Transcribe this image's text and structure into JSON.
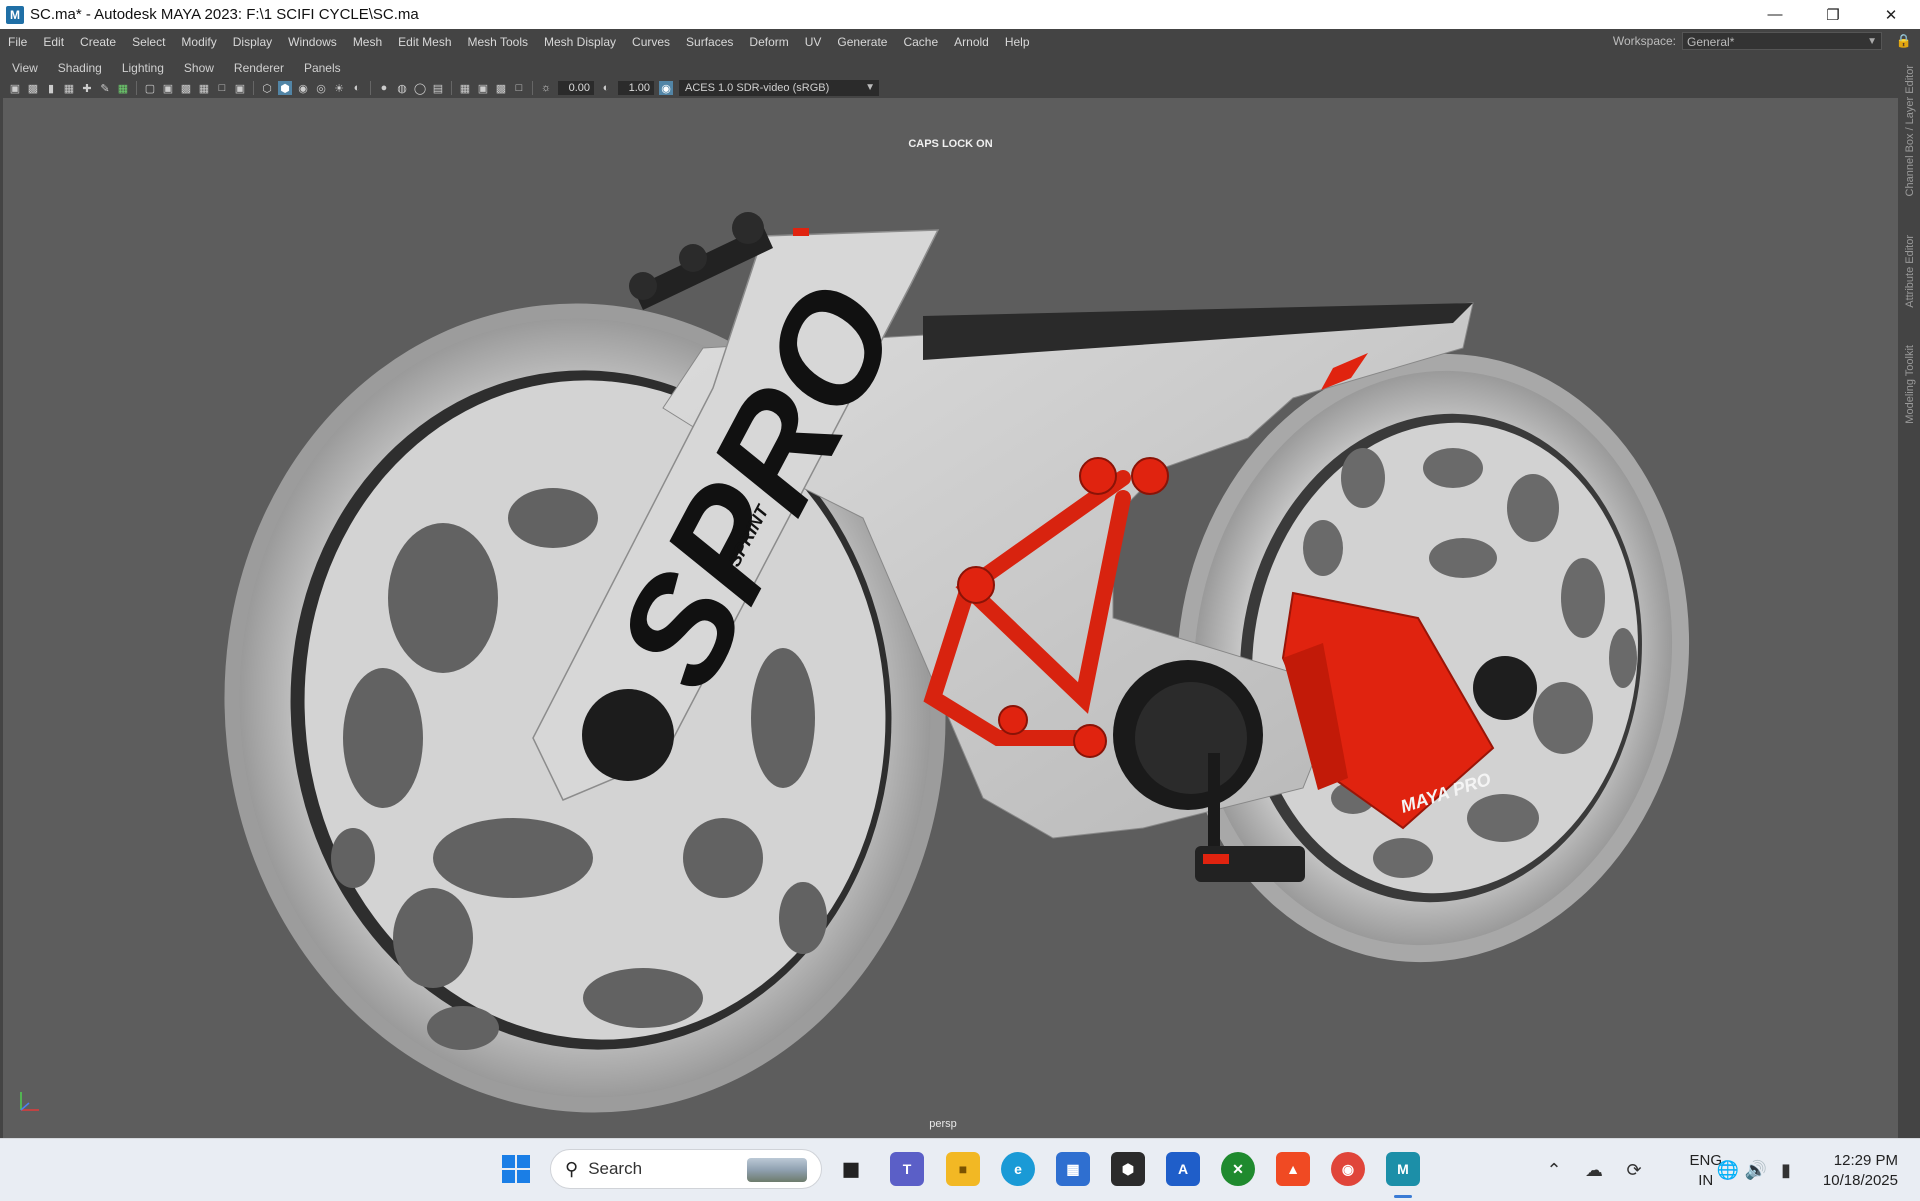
{
  "window": {
    "title": "SC.ma* - Autodesk MAYA 2023: F:\\1 SCIFI CYCLE\\SC.ma",
    "app_icon_letter": "M",
    "controls": [
      "minimize-icon",
      "restore-icon",
      "close-icon"
    ]
  },
  "menubar": {
    "items": [
      "File",
      "Edit",
      "Create",
      "Select",
      "Modify",
      "Display",
      "Windows",
      "Mesh",
      "Edit Mesh",
      "Mesh Tools",
      "Mesh Display",
      "Curves",
      "Surfaces",
      "Deform",
      "UV",
      "Generate",
      "Cache",
      "Arnold",
      "Help"
    ],
    "workspace_label": "Workspace:",
    "workspace_value": "General*"
  },
  "panel_menu": {
    "items": [
      "View",
      "Shading",
      "Lighting",
      "Show",
      "Renderer",
      "Panels"
    ]
  },
  "toolbar": {
    "exposure": "0.00",
    "gamma": "1.00",
    "color_space": "ACES 1.0 SDR-video (sRGB)"
  },
  "right_dock": {
    "tabs": [
      "Channel Box / Layer Editor",
      "Attribute Editor",
      "Modeling Toolkit"
    ]
  },
  "viewport": {
    "hud_message": "CAPS LOCK ON",
    "camera": "persp",
    "decals": {
      "frame_logo": "SPRO",
      "frame_sub": "SPRINT",
      "battery_logo": "MAYA PRO"
    }
  },
  "taskbar": {
    "search_placeholder": "Search",
    "apps": [
      "task-view",
      "teams",
      "file-explorer",
      "edge",
      "microsoft-store",
      "unity",
      "autodesk-app",
      "xbox",
      "brave",
      "chrome",
      "maya"
    ],
    "language_top": "ENG",
    "language_bottom": "IN",
    "time": "12:29 PM",
    "date": "10/18/2025"
  },
  "colors": {
    "viewport_bg": "#5d5d5d",
    "ui_bg": "#444444",
    "accent_red": "#e0230f",
    "selected_tool": "#5285a6"
  }
}
